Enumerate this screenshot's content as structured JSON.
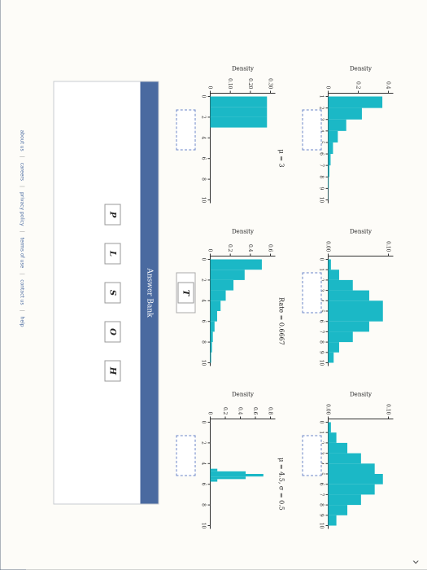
{
  "panels": [
    {
      "id": "p1",
      "title": "",
      "ylabel": "Density",
      "yticks": [
        "0",
        "0.2",
        "0.4"
      ],
      "xticks": [
        "1",
        "2",
        "3",
        "4",
        "5",
        "6",
        "7",
        "8",
        "9",
        "10"
      ],
      "xstart": 1
    },
    {
      "id": "p2",
      "title": "",
      "ylabel": "Density",
      "yticks": [
        "0.00",
        "0.10"
      ],
      "xticks": [
        "0",
        "1",
        "2",
        "3",
        "4",
        "5",
        "6",
        "7",
        "8",
        "9",
        "10"
      ],
      "xstart": 0
    },
    {
      "id": "p3",
      "title": "",
      "ylabel": "Density",
      "yticks": [
        "0.00",
        "0.10"
      ],
      "xticks": [
        "0",
        "1",
        "2",
        "3",
        "4",
        "5",
        "6",
        "7",
        "8",
        "9",
        "10"
      ],
      "xstart": 0
    },
    {
      "id": "p4",
      "title": "μ = 3",
      "ylabel": "Density",
      "yticks": [
        "0",
        "0.10",
        "0.20",
        "0.30"
      ],
      "xticks": [
        "0",
        "2",
        "4",
        "6",
        "8",
        "10"
      ],
      "xstart": 0
    },
    {
      "id": "p5",
      "title": "Rate = 0.6667",
      "ylabel": "Density",
      "yticks": [
        "0",
        "0.2",
        "0.4",
        "0.6"
      ],
      "xticks": [
        "0",
        "2",
        "4",
        "6",
        "8",
        "10"
      ],
      "xstart": 0
    },
    {
      "id": "p6",
      "title": "μ = 4.5, σ = 0.5",
      "ylabel": "Density",
      "yticks": [
        "0",
        "0.2",
        "0.4",
        "0.6",
        "0.8"
      ],
      "xticks": [
        "0",
        "2",
        "4",
        "6",
        "8",
        "10"
      ],
      "xstart": 0
    }
  ],
  "answers": {
    "p5": "T"
  },
  "bank": {
    "title": "Answer Bank",
    "tiles": [
      "P",
      "L",
      "S",
      "O",
      "H"
    ]
  },
  "footer": {
    "links": [
      "about us",
      "careers",
      "privacy policy",
      "terms of use",
      "contact us",
      "help"
    ]
  },
  "colors": {
    "bar": "#1bb8c6",
    "accent": "#4a6aa0"
  },
  "taskbar_icons": [
    "windows-icon",
    "ie-icon",
    "chrome-icon",
    "store-icon",
    "mail-icon"
  ]
}
